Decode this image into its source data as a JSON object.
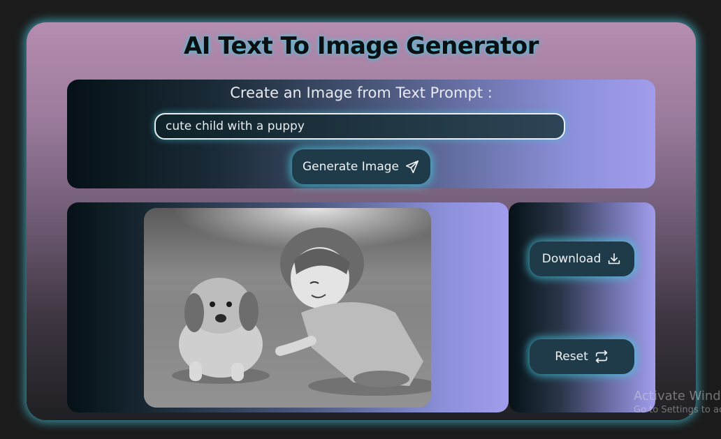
{
  "app": {
    "title": "AI Text To Image Generator"
  },
  "prompt_panel": {
    "heading": "Create an Image from Text Prompt :",
    "input_value": "cute child with a puppy",
    "generate_label": "Generate Image",
    "generate_icon": "paper-plane-icon"
  },
  "image_panel": {
    "image_alt": "cute child with a puppy"
  },
  "actions": {
    "download_label": "Download",
    "download_icon": "download-icon",
    "reset_label": "Reset",
    "reset_icon": "refresh-icon"
  },
  "watermark": {
    "line1": "Activate Windows",
    "line2": "Go to Settings to activate Windows."
  },
  "colors": {
    "page_bg": "#1b1b1b",
    "glow": "#46c8dc",
    "button_bg": "#1f3a48",
    "panel_light": "#a19dec"
  }
}
